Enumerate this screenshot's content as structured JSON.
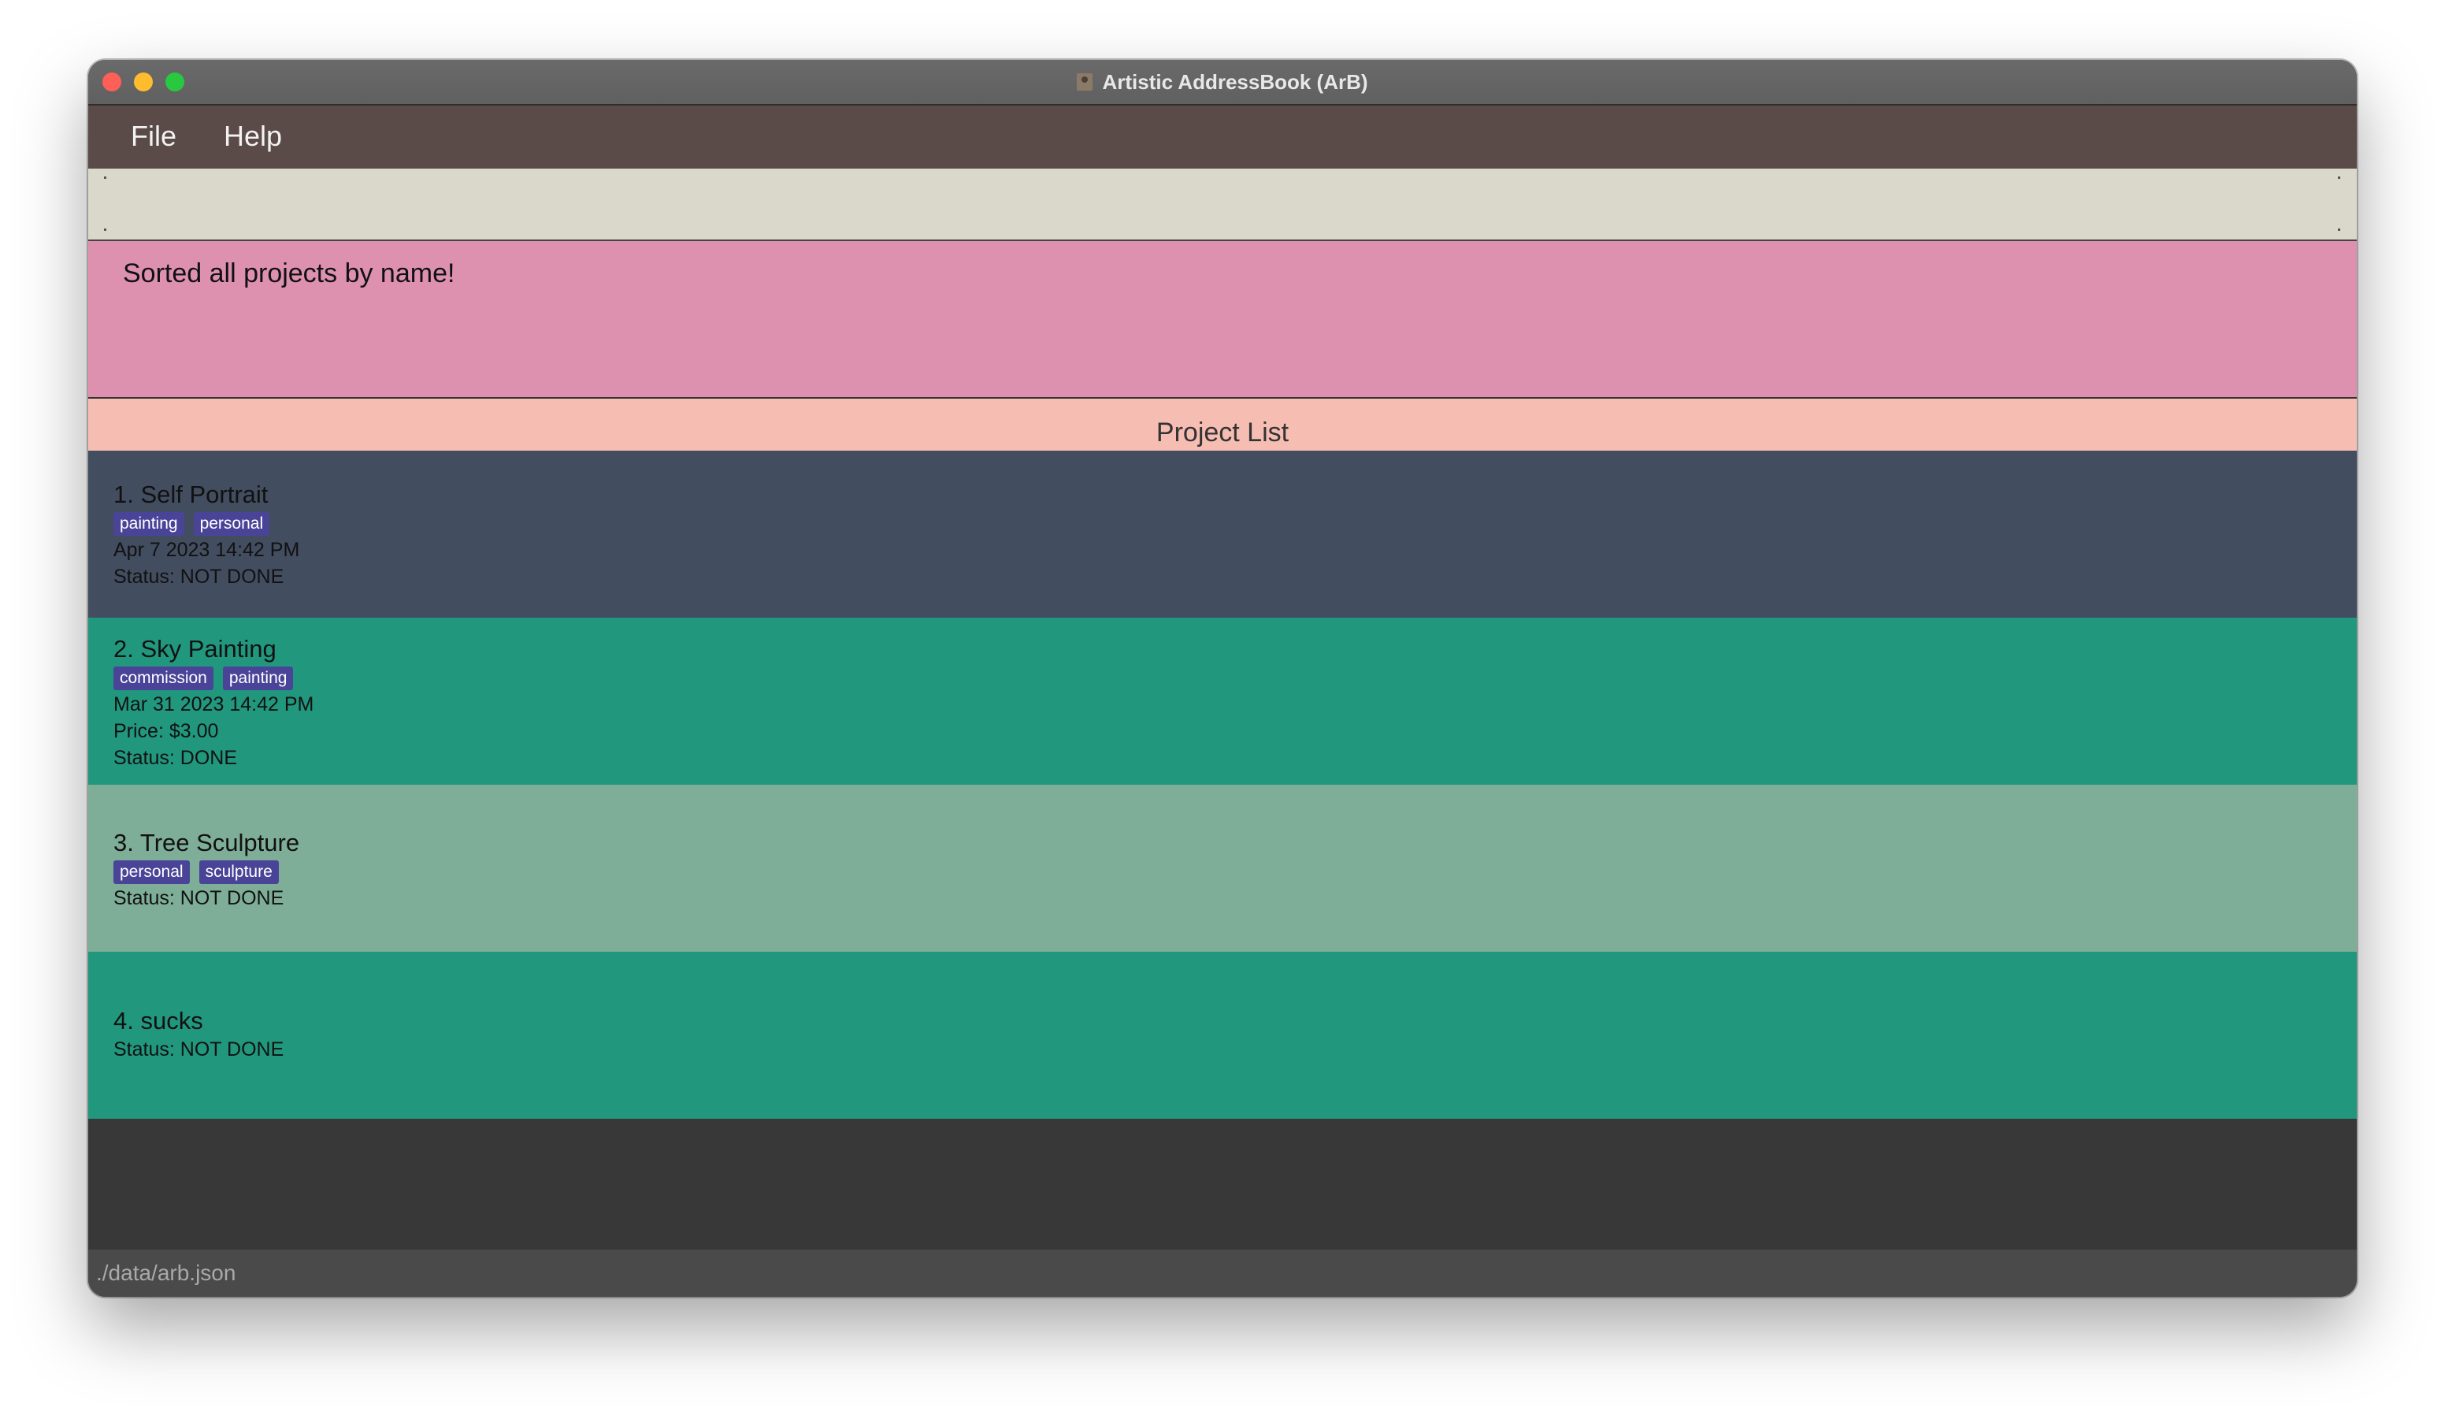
{
  "window": {
    "title": "Artistic AddressBook (ArB)"
  },
  "menu": {
    "file": "File",
    "help": "Help"
  },
  "command": {
    "value": "",
    "placeholder": ""
  },
  "result": {
    "message": "Sorted all projects by name!"
  },
  "project_list": {
    "header": "Project List",
    "items": [
      {
        "title": "1.  Self Portrait",
        "tags": [
          "painting",
          "personal"
        ],
        "deadline": "Apr 7 2023 14:42 PM",
        "status": "Status: NOT DONE"
      },
      {
        "title": "2.  Sky Painting",
        "tags": [
          "commission",
          "painting"
        ],
        "deadline": "Mar 31 2023 14:42 PM",
        "price": "Price: $3.00",
        "status": "Status: DONE"
      },
      {
        "title": "3.  Tree Sculpture",
        "tags": [
          "personal",
          "sculpture"
        ],
        "status": "Status: NOT DONE"
      },
      {
        "title": "4.  sucks",
        "status": "Status: NOT DONE"
      }
    ]
  },
  "statusbar": {
    "path": "./data/arb.json"
  },
  "colors": {
    "menubar": "#5b4b48",
    "command_box": "#dad7cb",
    "result_box": "#de91af",
    "list_header": "#f6bdb3",
    "card_dark": "#424d60",
    "card_teal": "#21977e",
    "card_sage": "#7eae98",
    "tag": "#4a4499"
  }
}
